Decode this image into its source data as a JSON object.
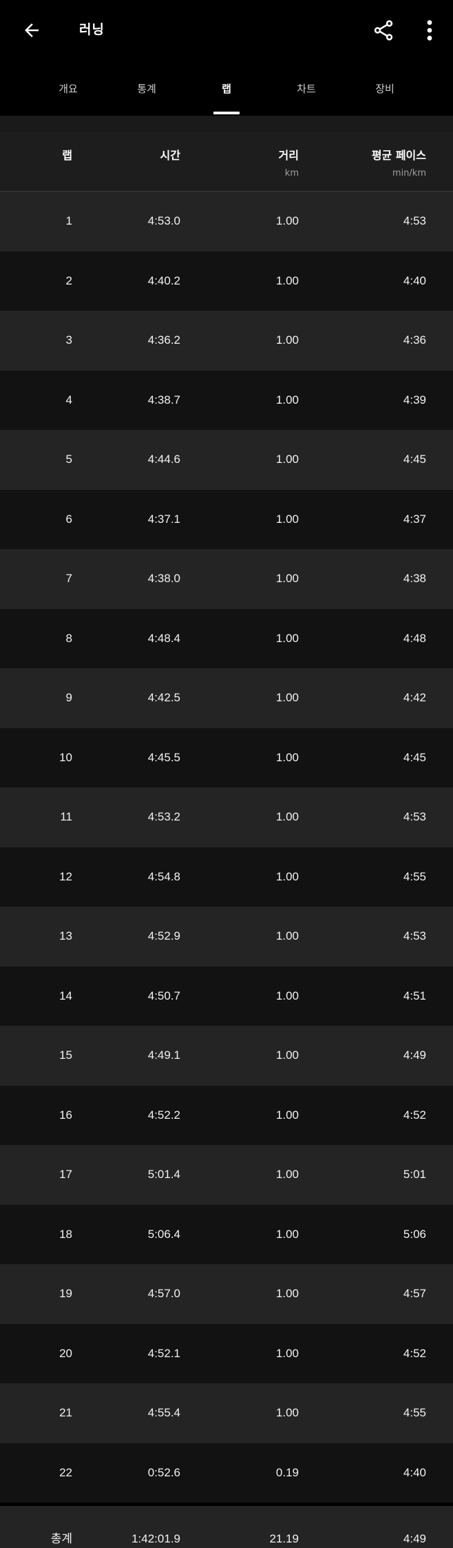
{
  "appbar": {
    "title": "러닝",
    "back_icon": "arrow-left-icon",
    "share_icon": "share-icon",
    "more_icon": "more-vertical-icon"
  },
  "tabs": [
    {
      "label": "개요",
      "active": false
    },
    {
      "label": "통계",
      "active": false
    },
    {
      "label": "랩",
      "active": true
    },
    {
      "label": "차트",
      "active": false
    },
    {
      "label": "장비",
      "active": false
    }
  ],
  "table": {
    "headers": {
      "lap": "랩",
      "time": "시간",
      "distance": "거리",
      "distance_unit": "km",
      "pace": "평균 페이스",
      "pace_unit": "min/km"
    },
    "rows": [
      {
        "lap": "1",
        "time": "4:53.0",
        "distance": "1.00",
        "pace": "4:53"
      },
      {
        "lap": "2",
        "time": "4:40.2",
        "distance": "1.00",
        "pace": "4:40"
      },
      {
        "lap": "3",
        "time": "4:36.2",
        "distance": "1.00",
        "pace": "4:36"
      },
      {
        "lap": "4",
        "time": "4:38.7",
        "distance": "1.00",
        "pace": "4:39"
      },
      {
        "lap": "5",
        "time": "4:44.6",
        "distance": "1.00",
        "pace": "4:45"
      },
      {
        "lap": "6",
        "time": "4:37.1",
        "distance": "1.00",
        "pace": "4:37"
      },
      {
        "lap": "7",
        "time": "4:38.0",
        "distance": "1.00",
        "pace": "4:38"
      },
      {
        "lap": "8",
        "time": "4:48.4",
        "distance": "1.00",
        "pace": "4:48"
      },
      {
        "lap": "9",
        "time": "4:42.5",
        "distance": "1.00",
        "pace": "4:42"
      },
      {
        "lap": "10",
        "time": "4:45.5",
        "distance": "1.00",
        "pace": "4:45"
      },
      {
        "lap": "11",
        "time": "4:53.2",
        "distance": "1.00",
        "pace": "4:53"
      },
      {
        "lap": "12",
        "time": "4:54.8",
        "distance": "1.00",
        "pace": "4:55"
      },
      {
        "lap": "13",
        "time": "4:52.9",
        "distance": "1.00",
        "pace": "4:53"
      },
      {
        "lap": "14",
        "time": "4:50.7",
        "distance": "1.00",
        "pace": "4:51"
      },
      {
        "lap": "15",
        "time": "4:49.1",
        "distance": "1.00",
        "pace": "4:49"
      },
      {
        "lap": "16",
        "time": "4:52.2",
        "distance": "1.00",
        "pace": "4:52"
      },
      {
        "lap": "17",
        "time": "5:01.4",
        "distance": "1.00",
        "pace": "5:01"
      },
      {
        "lap": "18",
        "time": "5:06.4",
        "distance": "1.00",
        "pace": "5:06"
      },
      {
        "lap": "19",
        "time": "4:57.0",
        "distance": "1.00",
        "pace": "4:57"
      },
      {
        "lap": "20",
        "time": "4:52.1",
        "distance": "1.00",
        "pace": "4:52"
      },
      {
        "lap": "21",
        "time": "4:55.4",
        "distance": "1.00",
        "pace": "4:55"
      },
      {
        "lap": "22",
        "time": "0:52.6",
        "distance": "0.19",
        "pace": "4:40"
      }
    ],
    "total": {
      "lap": "총계",
      "time": "1:42:01.9",
      "distance": "21.19",
      "pace": "4:49"
    }
  },
  "colors": {
    "background": "#000000",
    "row_light": "#242424",
    "row_dark": "#121212",
    "text": "#ffffff",
    "muted": "#a0a0a0"
  }
}
